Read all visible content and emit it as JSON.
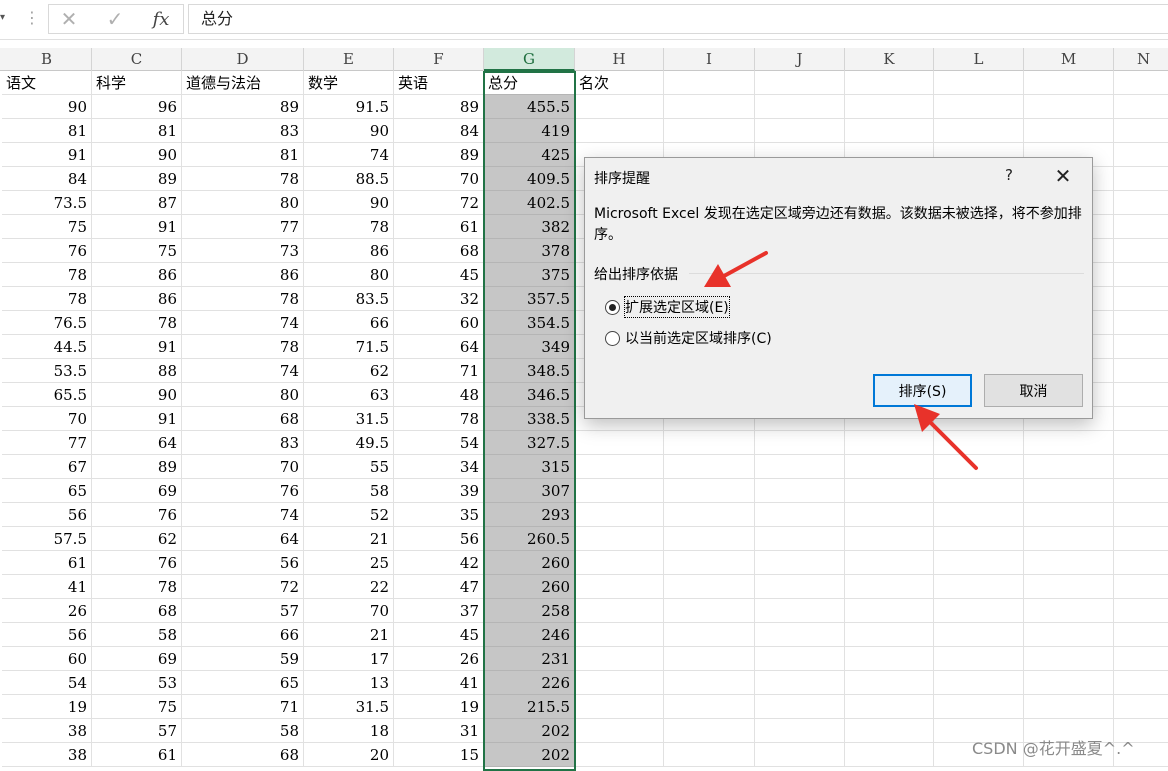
{
  "formula_bar": {
    "cancel_icon": "✕",
    "confirm_icon": "✓",
    "fx_label": "fx",
    "content": "总分"
  },
  "columns": [
    "B",
    "C",
    "D",
    "E",
    "F",
    "G",
    "H",
    "I",
    "J",
    "K",
    "L",
    "M",
    "N"
  ],
  "selected_column": "G",
  "headers": [
    "语文",
    "科学",
    "道德与法治",
    "数学",
    "英语",
    "总分",
    "名次"
  ],
  "rows": [
    [
      "90",
      "96",
      "89",
      "91.5",
      "89",
      "455.5"
    ],
    [
      "81",
      "81",
      "83",
      "90",
      "84",
      "419"
    ],
    [
      "91",
      "90",
      "81",
      "74",
      "89",
      "425"
    ],
    [
      "84",
      "89",
      "78",
      "88.5",
      "70",
      "409.5"
    ],
    [
      "73.5",
      "87",
      "80",
      "90",
      "72",
      "402.5"
    ],
    [
      "75",
      "91",
      "77",
      "78",
      "61",
      "382"
    ],
    [
      "76",
      "75",
      "73",
      "86",
      "68",
      "378"
    ],
    [
      "78",
      "86",
      "86",
      "80",
      "45",
      "375"
    ],
    [
      "78",
      "86",
      "78",
      "83.5",
      "32",
      "357.5"
    ],
    [
      "76.5",
      "78",
      "74",
      "66",
      "60",
      "354.5"
    ],
    [
      "44.5",
      "91",
      "78",
      "71.5",
      "64",
      "349"
    ],
    [
      "53.5",
      "88",
      "74",
      "62",
      "71",
      "348.5"
    ],
    [
      "65.5",
      "90",
      "80",
      "63",
      "48",
      "346.5"
    ],
    [
      "70",
      "91",
      "68",
      "31.5",
      "78",
      "338.5"
    ],
    [
      "77",
      "64",
      "83",
      "49.5",
      "54",
      "327.5"
    ],
    [
      "67",
      "89",
      "70",
      "55",
      "34",
      "315"
    ],
    [
      "65",
      "69",
      "76",
      "58",
      "39",
      "307"
    ],
    [
      "56",
      "76",
      "74",
      "52",
      "35",
      "293"
    ],
    [
      "57.5",
      "62",
      "64",
      "21",
      "56",
      "260.5"
    ],
    [
      "61",
      "76",
      "56",
      "25",
      "42",
      "260"
    ],
    [
      "41",
      "78",
      "72",
      "22",
      "47",
      "260"
    ],
    [
      "26",
      "68",
      "57",
      "70",
      "37",
      "258"
    ],
    [
      "56",
      "58",
      "66",
      "21",
      "45",
      "246"
    ],
    [
      "60",
      "69",
      "59",
      "17",
      "26",
      "231"
    ],
    [
      "54",
      "53",
      "65",
      "13",
      "41",
      "226"
    ],
    [
      "19",
      "75",
      "71",
      "31.5",
      "19",
      "215.5"
    ],
    [
      "38",
      "57",
      "58",
      "18",
      "31",
      "202"
    ],
    [
      "38",
      "61",
      "68",
      "20",
      "15",
      "202"
    ]
  ],
  "dialog": {
    "title": "排序提醒",
    "help": "?",
    "close_icon": "✕",
    "message": "Microsoft Excel 发现在选定区域旁边还有数据。该数据未被选择，将不参加排序。",
    "group_label": "给出排序依据",
    "option_expand": "扩展选定区域(E)",
    "option_current": "以当前选定区域排序(C)",
    "selected_option": "expand",
    "sort_button": "排序(S)",
    "cancel_button": "取消"
  },
  "annotation_color": "#e8322a",
  "watermark": "CSDN @花开盛夏^.^"
}
